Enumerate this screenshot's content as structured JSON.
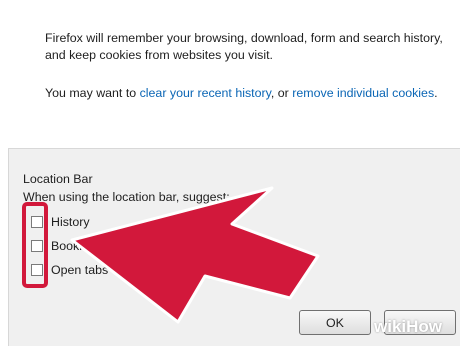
{
  "history": {
    "description": "Firefox will remember your browsing, download, form and search history, and keep cookies from websites you visit.",
    "hint_prefix": "You may want to ",
    "clear_link": "clear your recent history",
    "hint_middle": ", or ",
    "cookies_link": "remove individual cookies",
    "hint_suffix": "."
  },
  "location_bar": {
    "title": "Location Bar",
    "suggest_label": "When using the location bar, suggest:",
    "options": [
      {
        "label": "History",
        "checked": false
      },
      {
        "label": "Bookmarks",
        "checked": false
      },
      {
        "label": "Open tabs",
        "checked": false
      }
    ]
  },
  "buttons": {
    "ok": "OK",
    "cancel": ""
  },
  "annotation": {
    "color": "#d2183b"
  },
  "watermark": {
    "wiki": "wiki",
    "how": "How"
  }
}
